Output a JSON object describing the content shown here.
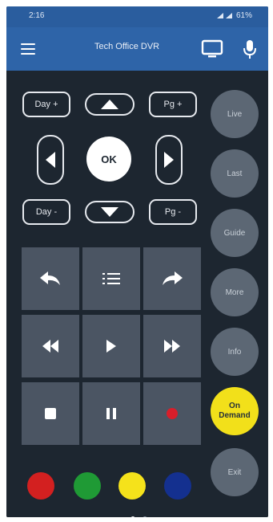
{
  "status_bar": {
    "time": "2:16",
    "battery": "61%"
  },
  "app_bar": {
    "device_name": "Tech Office DVR"
  },
  "dpad": {
    "day_up": "Day +",
    "day_down": "Day -",
    "page_up": "Pg +",
    "page_down": "Pg -",
    "ok": "OK"
  },
  "side_buttons": {
    "live": "Live",
    "last": "Last",
    "guide": "Guide",
    "more": "More",
    "info": "Info",
    "on_demand_line1": "On",
    "on_demand_line2": "Demand",
    "exit": "Exit"
  },
  "colors": {
    "accent_bar": "#2e64a8",
    "on_demand": "#f2e01a",
    "red": "#d32020",
    "green": "#1f9a35",
    "yellow": "#f5e21b",
    "blue": "#14308f",
    "record": "#d81e2a"
  },
  "pager": {
    "pages": 2,
    "active": 1
  }
}
